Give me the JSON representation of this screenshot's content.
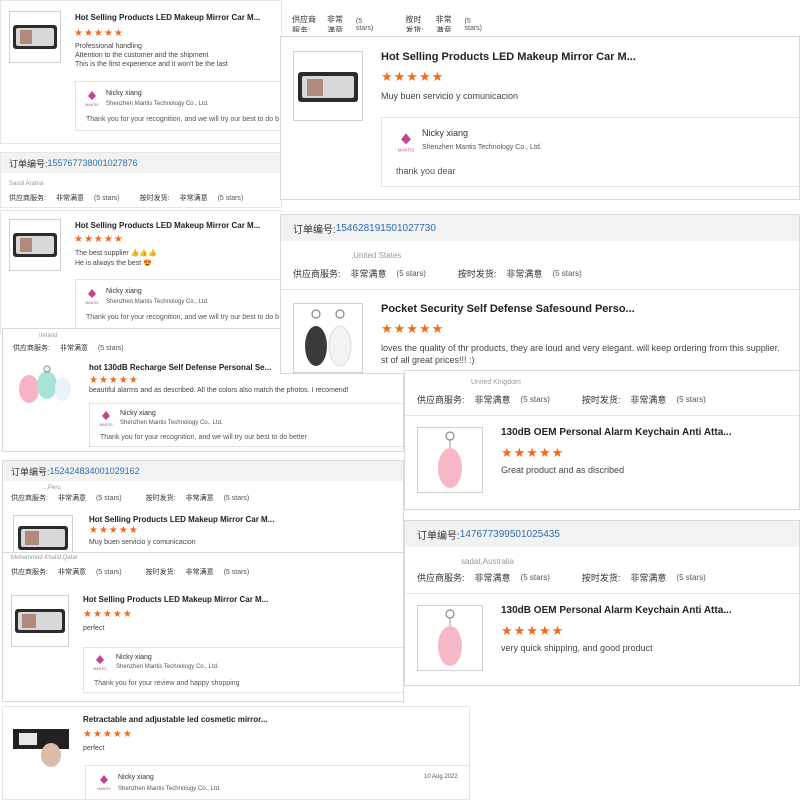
{
  "labels": {
    "order_prefix": "订单编号: ",
    "supplier_service": "供应商服务:",
    "ship_on_time": "按时发货:",
    "very_satisfied": "非常满意",
    "five_stars": "(5 stars)",
    "rating_stars": "★★★★★",
    "company": "Shenzhen Mantis Technology Co., Ltd.",
    "seller": "Nicky xiang",
    "logo_text": "MANTIS"
  },
  "card_a": {
    "title": "Hot Selling Products LED Makeup Mirror Car M...",
    "review": [
      "Professional handling",
      "Attention to the customer and the shipment",
      "This is the first experience and it won't be the last"
    ],
    "reply": "Thank you for your recognition, and we will try our best to do b"
  },
  "card_b": {
    "title": "Hot Selling Products LED Makeup Mirror Car M...",
    "review": "Muy buen servicio y comunicacion",
    "reply": "thank you dear"
  },
  "order_1": {
    "number": "155767738001027876",
    "buyer": "Saudi Arabia"
  },
  "card_c": {
    "title": "Hot Selling Products LED Makeup Mirror Car M...",
    "review": [
      "The best supplier 👍👍👍",
      "He is always the best 😍"
    ],
    "reply": "Thank you for your recognition, and we will try our best to do b"
  },
  "order_2": {
    "number": "154628191501027730",
    "buyer": ",United States"
  },
  "card_d": {
    "title": "Pocket Security Self Defense Safesound Perso...",
    "review": [
      "loves the quality of thr products, they are loud and very elegant. will keep ordering from this supplier.",
      "st of all great prices!!! :)"
    ]
  },
  "card_e": {
    "buyer": "Ireland",
    "title": "hot 130dB Recharge Self Defense Personal Se...",
    "review": "beautiful alarms and as described. All the colors also match the photos. I recomend!",
    "reply": "Thank you for your recognition, and we will try our best to do better"
  },
  "card_f": {
    "buyer": "United Kingdom",
    "title": "130dB OEM Personal Alarm Keychain Anti Atta...",
    "review": "Great product and as discribed"
  },
  "order_3": {
    "number": "152424834001029162",
    "buyer": "..,Peru"
  },
  "card_g": {
    "title": "Hot Selling Products LED Makeup Mirror Car M...",
    "review": "Muy buen servicio y comunicacion"
  },
  "order_4": {
    "number": "147677399501025435",
    "buyer": "sadat,Australia"
  },
  "card_h": {
    "title": "130dB OEM Personal Alarm Keychain Anti Atta...",
    "review": "very quick shipping, and good product"
  },
  "card_i": {
    "buyer": "Mohammed Khalid,Qatar",
    "title": "Hot Selling Products LED Makeup Mirror Car M...",
    "review": "perfect",
    "reply": "Thank you for your review and happy shopping"
  },
  "card_j": {
    "title": "Retractable and adjustable led cosmetic mirror...",
    "review": "perfect",
    "date": "10 Aug 2022"
  },
  "colors": {
    "star": "#f26b1d",
    "order_link": "#2b6cb0",
    "header_bg": "#f2f2f2"
  },
  "icons": [
    "makeup-mirror-icon",
    "keychain-alarm-icon",
    "mantis-logo-icon"
  ]
}
